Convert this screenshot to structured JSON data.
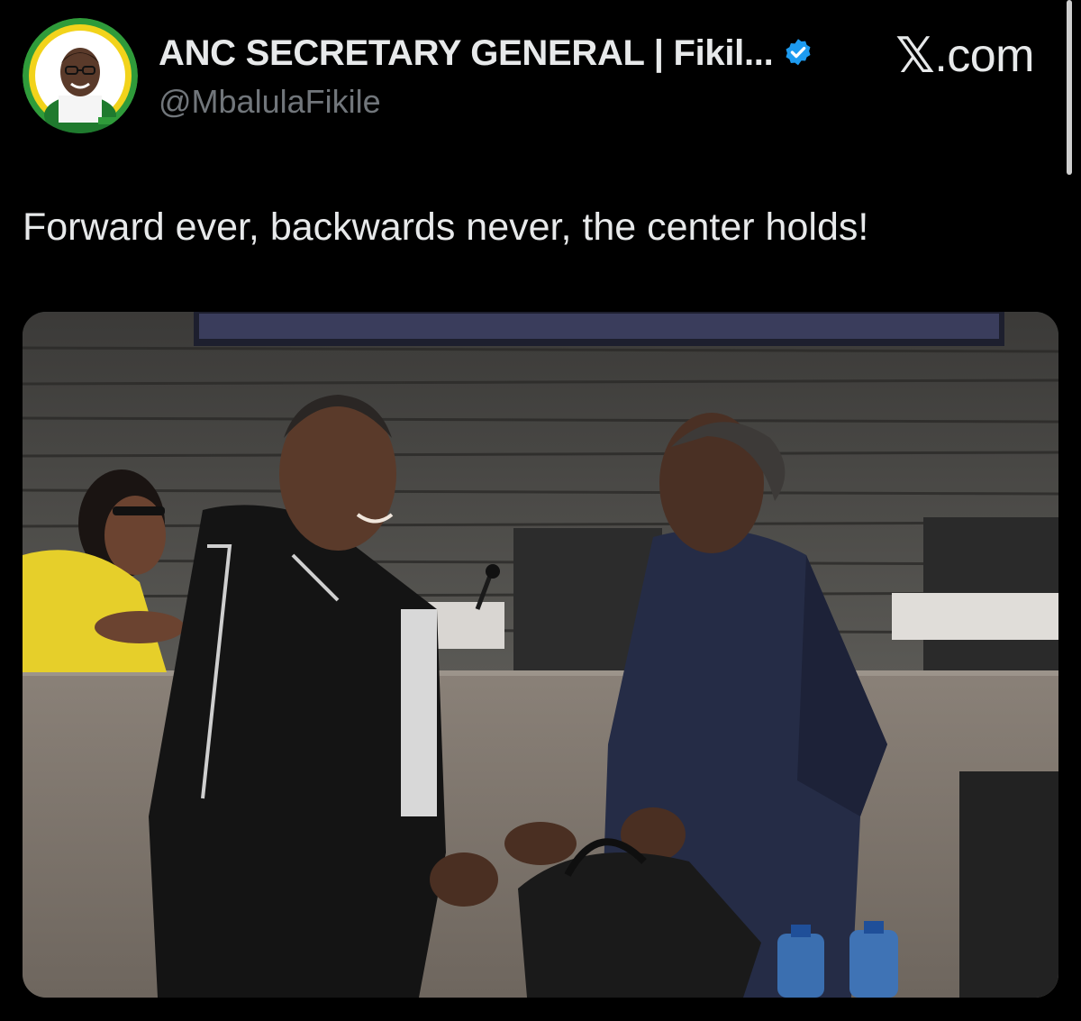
{
  "author": {
    "display_name": "ANC SECRETARY GENERAL | Fikil...",
    "handle": "@MbalulaFikile",
    "verified": true,
    "avatar_icon": "profile-avatar-icon"
  },
  "brand": {
    "x_glyph": "𝕏",
    "suffix": ".com"
  },
  "tweet": {
    "text": "Forward ever, backwards never, the center holds!"
  },
  "media": {
    "type": "photo",
    "icon": "photo-icon"
  },
  "colors": {
    "background": "#000000",
    "text_primary": "#e7e9ea",
    "text_secondary": "#71767b",
    "verified_blue": "#1d9bf0",
    "avatar_ring_green": "#2f9b3a",
    "avatar_ring_yellow": "#f2d31b"
  }
}
